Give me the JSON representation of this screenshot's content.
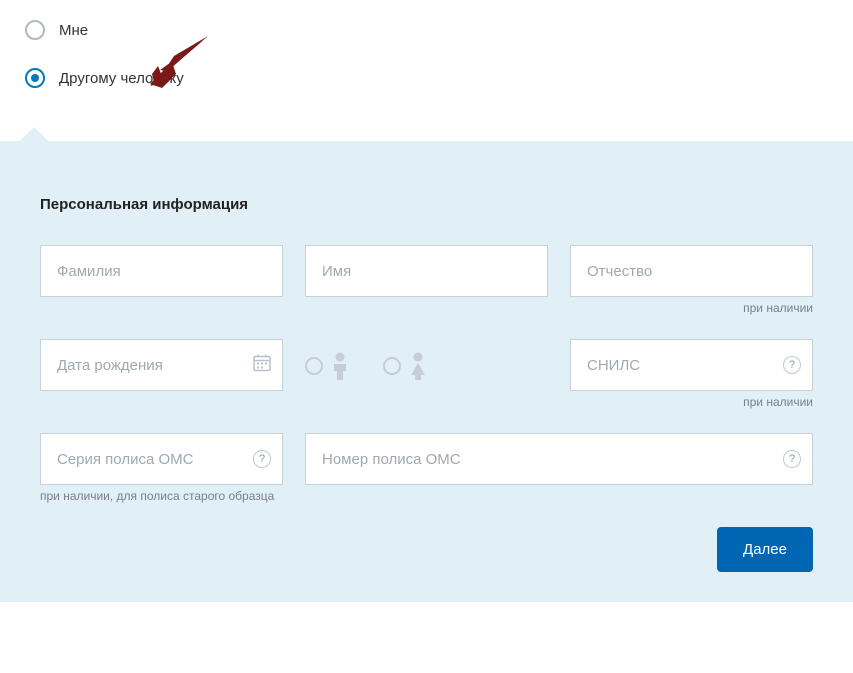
{
  "recipient": {
    "option_self": "Мне",
    "option_other": "Другому человеку"
  },
  "form": {
    "section_title": "Персональная информация",
    "surname_placeholder": "Фамилия",
    "name_placeholder": "Имя",
    "patronymic_placeholder": "Отчество",
    "patronymic_hint": "при наличии",
    "birthdate_placeholder": "Дата рождения",
    "snils_placeholder": "СНИЛС",
    "snils_hint": "при наличии",
    "oms_series_placeholder": "Серия полиса ОМС",
    "oms_series_hint": "при наличии, для полиса старого образца",
    "oms_number_placeholder": "Номер полиса ОМС",
    "help_symbol": "?"
  },
  "actions": {
    "next_label": "Далее"
  }
}
